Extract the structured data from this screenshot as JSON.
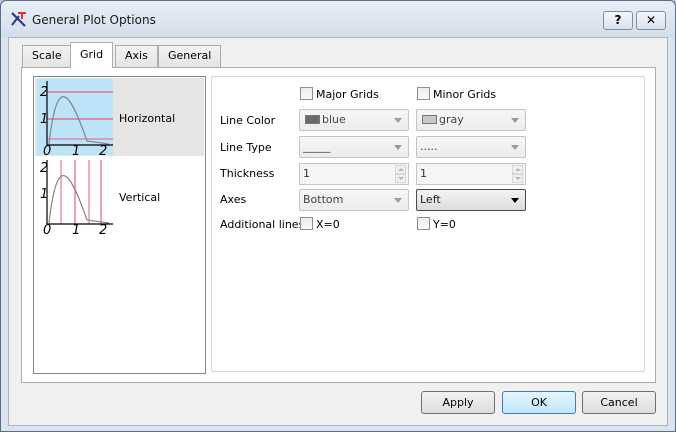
{
  "window": {
    "title": "General Plot Options",
    "help_label": "?",
    "close_label": "✕"
  },
  "tabs": [
    {
      "label": "Scale"
    },
    {
      "label": "Grid"
    },
    {
      "label": "Axis"
    },
    {
      "label": "General"
    }
  ],
  "grid_list": {
    "items": [
      {
        "label": "Horizontal",
        "selected": true,
        "ticks_x": [
          "0",
          "1",
          "2"
        ],
        "ticks_y": [
          "2",
          "1"
        ]
      },
      {
        "label": "Vertical",
        "selected": false,
        "ticks_x": [
          "0",
          "1",
          "2"
        ],
        "ticks_y": [
          "2",
          "1"
        ]
      }
    ]
  },
  "options": {
    "major_grids_label": "Major Grids",
    "minor_grids_label": "Minor Grids",
    "line_color_label": "Line Color",
    "major_color": "blue",
    "major_color_hex": "#6b6b6b",
    "minor_color": "gray",
    "minor_color_hex": "#c8c8c8",
    "line_type_label": "Line Type",
    "major_line_type": "_____",
    "minor_line_type": ".....",
    "thickness_label": "Thickness",
    "major_thickness": "1",
    "minor_thickness": "1",
    "axes_label": "Axes",
    "major_axes": "Bottom",
    "minor_axes": "Left",
    "additional_lines_label": "Additional lines",
    "x0_label": "X=0",
    "y0_label": "Y=0"
  },
  "buttons": {
    "apply": "Apply",
    "ok": "OK",
    "cancel": "Cancel"
  }
}
